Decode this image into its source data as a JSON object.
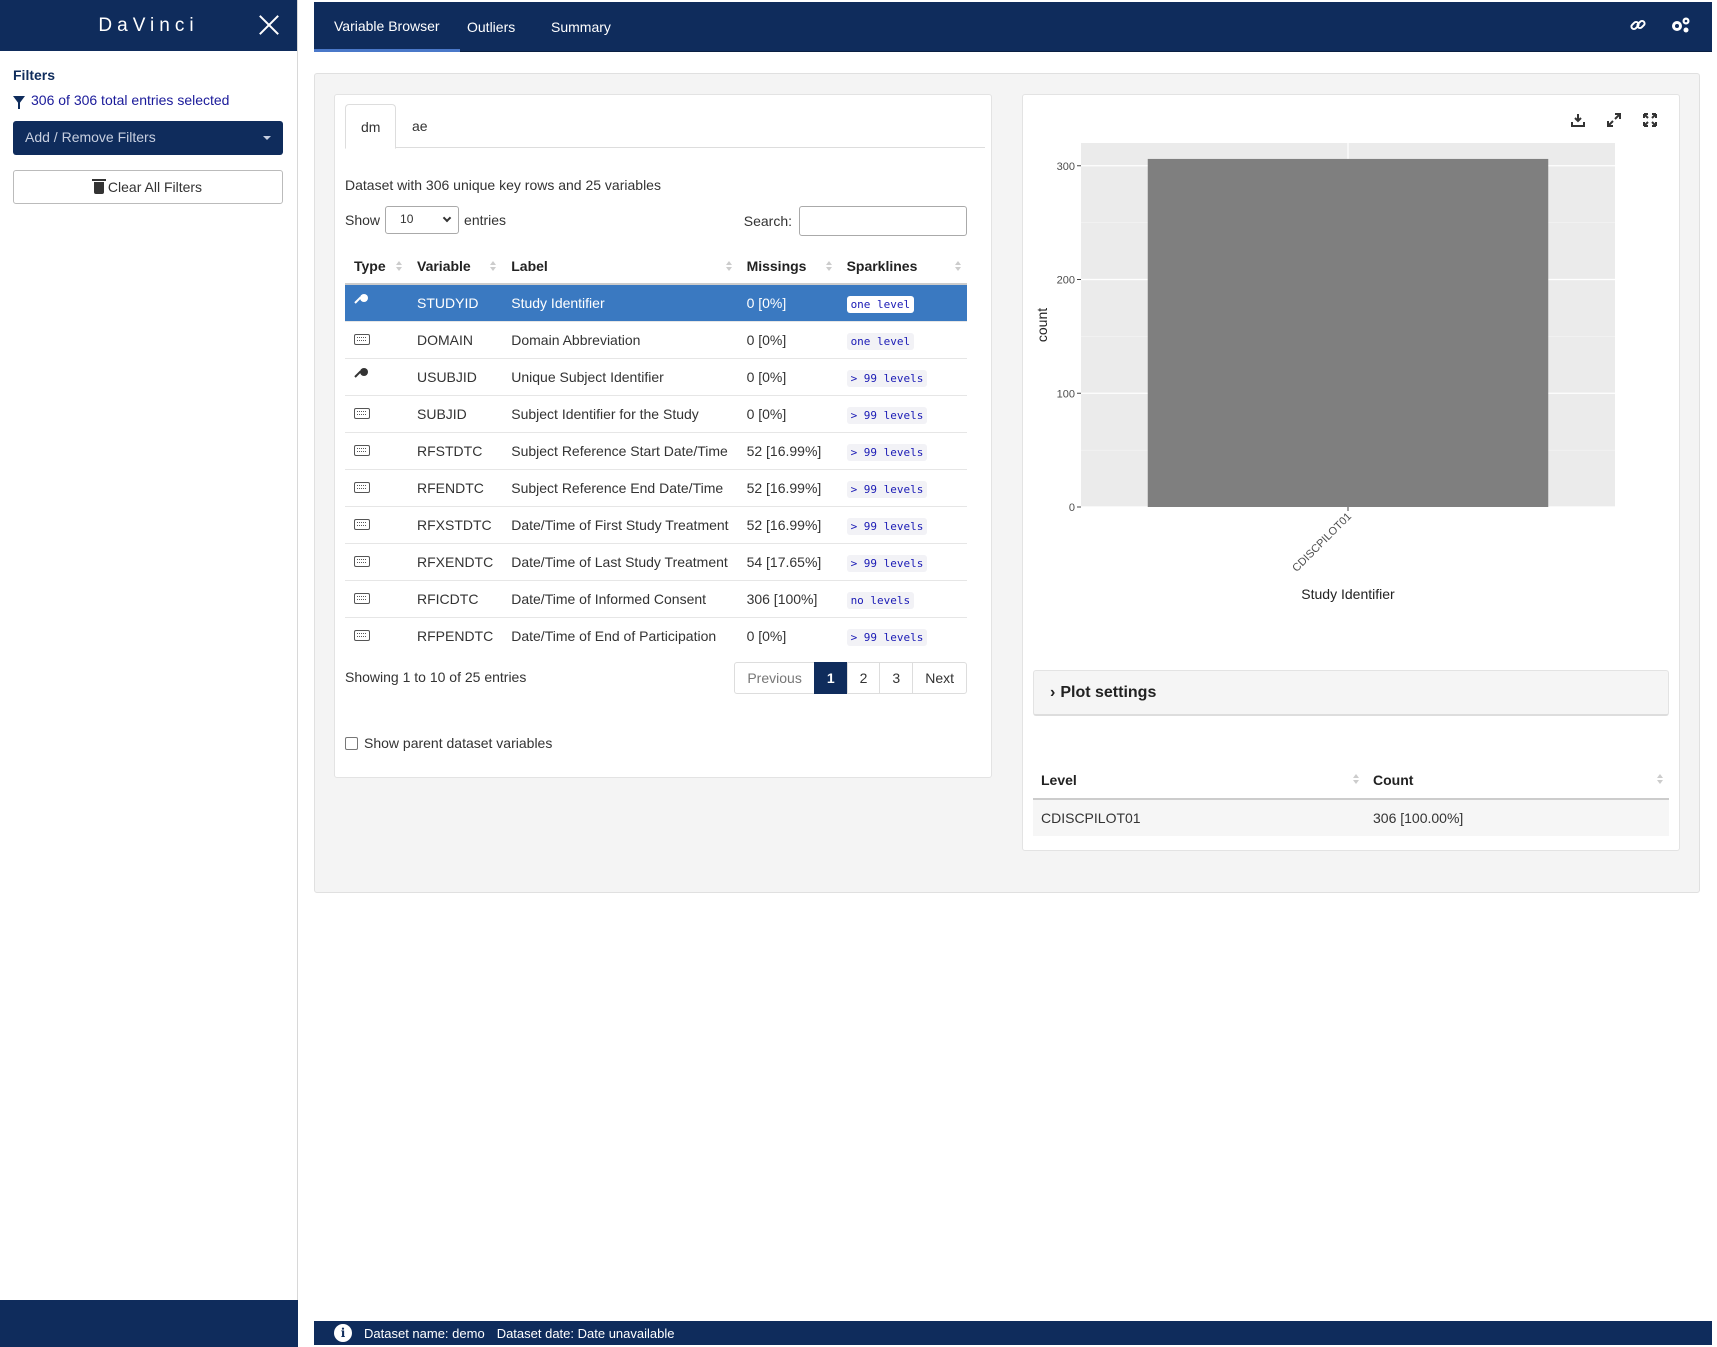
{
  "sidebar": {
    "brand": "DaVinci",
    "filters_title": "Filters",
    "filters_summary": "306 of 306 total entries selected",
    "add_remove_label": "Add / Remove Filters",
    "clear_label": "Clear All Filters"
  },
  "navbar": {
    "tabs": [
      {
        "label": "Variable Browser",
        "active": true
      },
      {
        "label": "Outliers",
        "active": false
      },
      {
        "label": "Summary",
        "active": false
      }
    ],
    "icons": [
      "link-icon",
      "gears-icon"
    ]
  },
  "dataset_tabs": [
    {
      "label": "dm",
      "active": true
    },
    {
      "label": "ae",
      "active": false
    }
  ],
  "dataset_info": "Dataset with 306 unique key rows and 25 variables",
  "table_controls": {
    "show_label": "Show",
    "entries_value": "10",
    "entries_label": "entries",
    "search_label": "Search:",
    "search_value": ""
  },
  "variable_table": {
    "columns": [
      "Type",
      "Variable",
      "Label",
      "Missings",
      "Sparklines"
    ],
    "rows": [
      {
        "type": "key",
        "variable": "STUDYID",
        "label": "Study Identifier",
        "missings": "0 [0%]",
        "sparkline": "one level",
        "selected": true
      },
      {
        "type": "keyboard",
        "variable": "DOMAIN",
        "label": "Domain Abbreviation",
        "missings": "0 [0%]",
        "sparkline": "one level",
        "selected": false
      },
      {
        "type": "key",
        "variable": "USUBJID",
        "label": "Unique Subject Identifier",
        "missings": "0 [0%]",
        "sparkline": "> 99 levels",
        "selected": false
      },
      {
        "type": "keyboard",
        "variable": "SUBJID",
        "label": "Subject Identifier for the Study",
        "missings": "0 [0%]",
        "sparkline": "> 99 levels",
        "selected": false
      },
      {
        "type": "keyboard",
        "variable": "RFSTDTC",
        "label": "Subject Reference Start Date/Time",
        "missings": "52 [16.99%]",
        "sparkline": "> 99 levels",
        "selected": false
      },
      {
        "type": "keyboard",
        "variable": "RFENDTC",
        "label": "Subject Reference End Date/Time",
        "missings": "52 [16.99%]",
        "sparkline": "> 99 levels",
        "selected": false
      },
      {
        "type": "keyboard",
        "variable": "RFXSTDTC",
        "label": "Date/Time of First Study Treatment",
        "missings": "52 [16.99%]",
        "sparkline": "> 99 levels",
        "selected": false
      },
      {
        "type": "keyboard",
        "variable": "RFXENDTC",
        "label": "Date/Time of Last Study Treatment",
        "missings": "54 [17.65%]",
        "sparkline": "> 99 levels",
        "selected": false
      },
      {
        "type": "keyboard",
        "variable": "RFICDTC",
        "label": "Date/Time of Informed Consent",
        "missings": "306 [100%]",
        "sparkline": "no levels",
        "selected": false
      },
      {
        "type": "keyboard",
        "variable": "RFPENDTC",
        "label": "Date/Time of End of Participation",
        "missings": "0 [0%]",
        "sparkline": "> 99 levels",
        "selected": false
      }
    ]
  },
  "pagination": {
    "showing": "Showing 1 to 10 of 25 entries",
    "previous": "Previous",
    "pages": [
      "1",
      "2",
      "3"
    ],
    "active_page": "1",
    "next": "Next"
  },
  "parent_checkbox_label": "Show parent dataset variables",
  "chart_data": {
    "type": "bar",
    "categories": [
      "CDISCPILOT01"
    ],
    "values": [
      306
    ],
    "xlabel": "Study Identifier",
    "ylabel": "count",
    "ylim": [
      0,
      320
    ],
    "yticks": [
      0,
      100,
      200,
      300
    ],
    "grid": true,
    "bar_color": "#7f7f7f",
    "panel_color": "#ebebeb"
  },
  "plot_settings_label": "Plot settings",
  "level_table": {
    "columns": [
      "Level",
      "Count"
    ],
    "rows": [
      {
        "level": "CDISCPILOT01",
        "count": "306 [100.00%]"
      }
    ]
  },
  "footer": {
    "dataset_name": "Dataset name: demo",
    "dataset_date": "Dataset date: Date unavailable"
  },
  "colors": {
    "navy": "#0f2c5c",
    "selected_row": "#3a79c1",
    "sparkline_text": "#1a1ab5"
  }
}
